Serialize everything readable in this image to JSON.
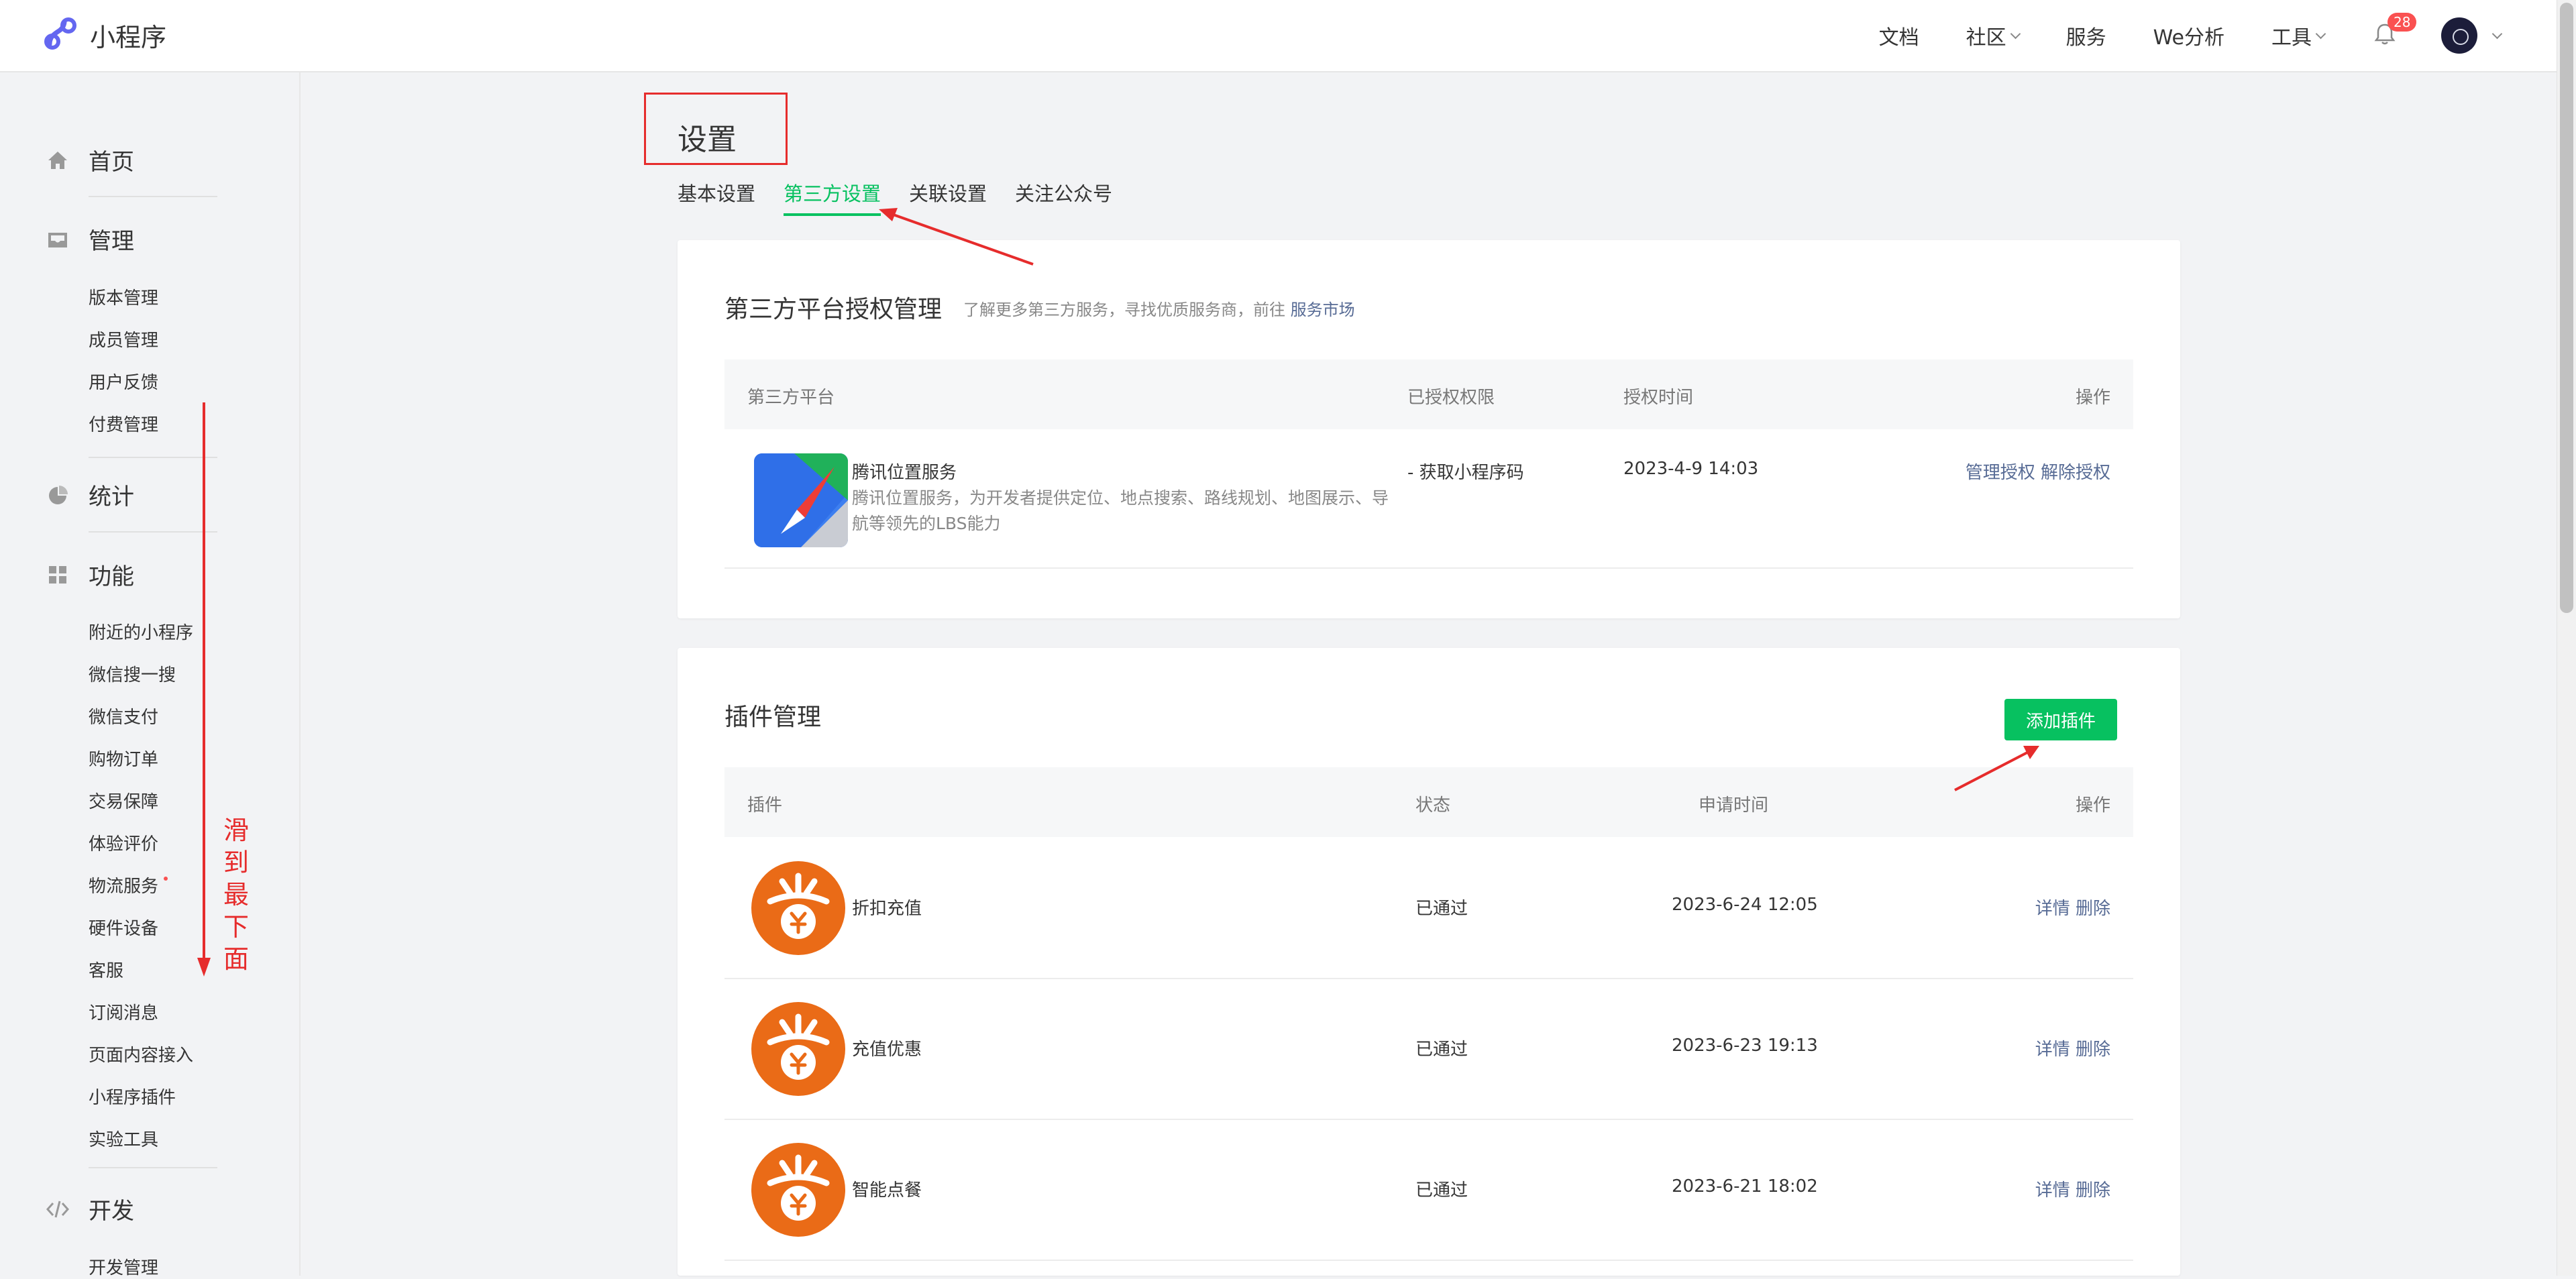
{
  "header": {
    "app_name": "小程序",
    "nav": [
      {
        "label": "文档",
        "has_dropdown": false
      },
      {
        "label": "社区",
        "has_dropdown": true
      },
      {
        "label": "服务",
        "has_dropdown": false
      },
      {
        "label": "We分析",
        "has_dropdown": false
      },
      {
        "label": "工具",
        "has_dropdown": true
      }
    ],
    "notification_count": "28",
    "icons": [
      "logo-icon",
      "bell-icon",
      "avatar",
      "chevron-down-icon"
    ]
  },
  "sidebar": {
    "home": "首页",
    "manage": {
      "label": "管理",
      "items": [
        "版本管理",
        "成员管理",
        "用户反馈",
        "付费管理"
      ]
    },
    "stats": "统计",
    "features": {
      "label": "功能",
      "items": [
        "附近的小程序",
        "微信搜一搜",
        "微信支付",
        "购物订单",
        "交易保障",
        "体验评价",
        "物流服务",
        "硬件设备",
        "客服",
        "订阅消息",
        "页面内容接入",
        "小程序插件",
        "实验工具"
      ]
    },
    "dev": {
      "label": "开发",
      "items": [
        "开发管理"
      ]
    }
  },
  "annotation": {
    "scroll_hint_chars": [
      "滑",
      "到",
      "最",
      "下",
      "面"
    ],
    "color": "#e62c2c"
  },
  "main": {
    "title": "设置",
    "tabs": [
      {
        "label": "基本设置",
        "active": false
      },
      {
        "label": "第三方设置",
        "active": true
      },
      {
        "label": "关联设置",
        "active": false
      },
      {
        "label": "关注公众号",
        "active": false
      }
    ],
    "third_party": {
      "title": "第三方平台授权管理",
      "subtitle": "了解更多第三方服务，寻找优质服务商，前往",
      "subtitle_link": "服务市场",
      "columns": [
        "第三方平台",
        "已授权权限",
        "授权时间",
        "操作"
      ],
      "rows": [
        {
          "name": "腾讯位置服务",
          "desc": "腾讯位置服务，为开发者提供定位、地点搜索、路线规划、地图展示、导航等领先的LBS能力",
          "permission": "- 获取小程序码",
          "time": "2023-4-9 14:03",
          "action1": "管理授权",
          "action2": "解除授权"
        }
      ]
    },
    "plugins": {
      "title": "插件管理",
      "add_button": "添加插件",
      "columns": [
        "插件",
        "状态",
        "申请时间",
        "操作"
      ],
      "rows": [
        {
          "name": "折扣充值",
          "status": "已通过",
          "time": "2023-6-24 12:05",
          "detail": "详情",
          "delete": "删除"
        },
        {
          "name": "充值优惠",
          "status": "已通过",
          "time": "2023-6-23 19:13",
          "detail": "详情",
          "delete": "删除"
        },
        {
          "name": "智能点餐",
          "status": "已通过",
          "time": "2023-6-21 18:02",
          "detail": "详情",
          "delete": "删除"
        }
      ]
    }
  },
  "colors": {
    "accent": "#07c160",
    "link": "#576b95",
    "badge": "#fa5151",
    "plugin_icon": "#ea6b17",
    "annotation": "#e62c2c"
  }
}
